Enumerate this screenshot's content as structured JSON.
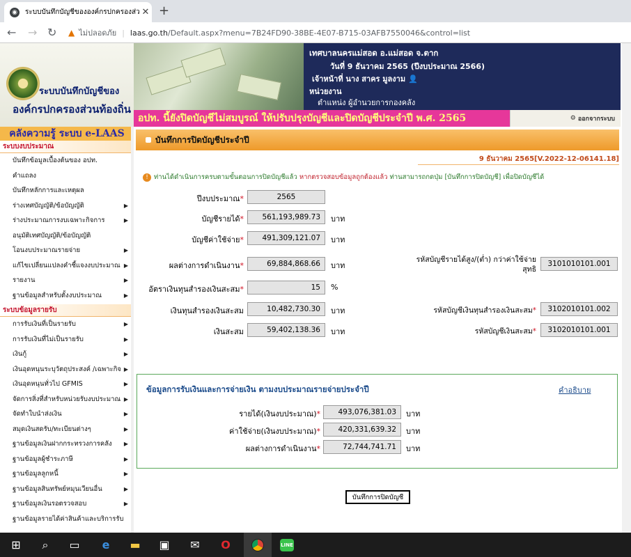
{
  "browser": {
    "tab_title": "ระบบบันทึกบัญชีขององค์กรปกครองส่วนท้องถิ่น",
    "new_tab": "+",
    "security_text": "ไม่ปลอดภัย",
    "url_host": "laas.go.th",
    "url_path": "/Default.aspx?menu=7B24FD90-38BE-4E07-B715-03AFB7550046&control=list"
  },
  "header": {
    "app_title": "ระบบบันทึกบัญชีของ",
    "org_name": "องค์กรปกครองส่วนท้องถิ่น",
    "municipality": "เทศบาลนครแม่สอด อ.แม่สอด จ.ตาก",
    "date_line": "วันที่ 9 ธันวาคม 2565  (ปีงบประมาณ 2566)",
    "officer": "เจ้าหน้าที่ นาง สาคร มูลงาม",
    "unit": "หน่วยงาน",
    "position": "ตำแหน่ง ผู้อำนวยการกองคลัง",
    "marquee": "อปท. นี้ยังปิดบัญชีไม่สมบูรณ์ ให้ปรับปรุงบัญชีและปิดบัญชีประจำปี พ.ศ. 2565",
    "logout": "ออกจากระบบ"
  },
  "sidebar": {
    "knowledge": "คลังความรู้ ระบบ e-LAAS",
    "section1": "ระบบงบประมาณ",
    "items1": [
      {
        "label": "บันทึกข้อมูลเบื้องต้นของ อปท.",
        "arrow": ""
      },
      {
        "label": "คำแถลง",
        "arrow": ""
      },
      {
        "label": "บันทึกหลักการและเหตุผล",
        "arrow": ""
      },
      {
        "label": "ร่างเทศบัญญัติ/ข้อบัญญัติ",
        "arrow": "▶"
      },
      {
        "label": "ร่างประมาณการงบเฉพาะกิจการ",
        "arrow": "▶"
      },
      {
        "label": "อนุมัติเทศบัญญัติ/ข้อบัญญัติ",
        "arrow": ""
      },
      {
        "label": "โอนงบประมาณรายจ่าย",
        "arrow": "▶"
      },
      {
        "label": "แก้ไขเปลี่ยนแปลงคำชี้แจงงบประมาณ",
        "arrow": "▶"
      },
      {
        "label": "รายงาน",
        "arrow": "▶"
      },
      {
        "label": "ฐานข้อมูลสำหรับตั้งงบประมาณ",
        "arrow": "▶"
      }
    ],
    "section2": "ระบบข้อมูลรายรับ",
    "items2": [
      {
        "label": "การรับเงินที่เป็นรายรับ",
        "arrow": "▶"
      },
      {
        "label": "การรับเงินที่ไม่เป็นรายรับ",
        "arrow": "▶"
      },
      {
        "label": "เงินกู้",
        "arrow": "▶"
      },
      {
        "label": "เงินอุดหนุนระบุวัตถุประสงค์ /เฉพาะกิจ",
        "arrow": "▶"
      },
      {
        "label": "เงินอุดหนุนทั่วไป GFMIS",
        "arrow": "▶"
      },
      {
        "label": "จัดการสิ่งที่สำหรับหน่วยรับงบประมาณ",
        "arrow": "▶"
      },
      {
        "label": "จัดทำใบนำส่งเงิน",
        "arrow": "▶"
      },
      {
        "label": "สมุดเงินสดรับ/ทะเบียนต่างๆ",
        "arrow": "▶"
      },
      {
        "label": "ฐานข้อมูลเงินฝากกระทรวงการคลัง",
        "arrow": "▶"
      },
      {
        "label": "ฐานข้อมูลผู้ชำระภาษี",
        "arrow": "▶"
      },
      {
        "label": "ฐานข้อมูลลูกหนี้",
        "arrow": "▶"
      },
      {
        "label": "ฐานข้อมูลสินทรัพย์หมุนเวียนอื่น",
        "arrow": "▶"
      },
      {
        "label": "ฐานข้อมูลเงินรอตรวจสอบ",
        "arrow": "▶"
      },
      {
        "label": "ฐานข้อมูลรายได้ค่าสินค้าและบริการรับ",
        "arrow": ""
      }
    ]
  },
  "main": {
    "page_title": "บันทึกการปิดบัญชีประจำปี",
    "date_version": "9 ธันวาคม 2565[V.2022-12-06141.18]",
    "notice_1": "ท่านได้ดำเนินการครบตามขั้นตอนการปิดบัญชีแล้ว",
    "notice_2": "หากตรวจสอบข้อมูลถูกต้องแล้ว",
    "notice_3": "ท่านสามารถกดปุ่ม [บันทึกการปิดบัญชี] เพื่อปิดบัญชีได้",
    "fields": {
      "fiscal_year": {
        "label": "ปีงบประมาณ",
        "value": "2565"
      },
      "revenue": {
        "label": "บัญชีรายได้",
        "value": "561,193,989.73",
        "unit": "บาท"
      },
      "expense": {
        "label": "บัญชีค่าใช้จ่าย",
        "value": "491,309,121.07",
        "unit": "บาท"
      },
      "result": {
        "label": "ผลต่างการดำเนินงาน",
        "value": "69,884,868.66",
        "unit": "บาท"
      },
      "reserve_rate": {
        "label": "อัตราเงินทุนสำรองเงินสะสม",
        "value": "15",
        "unit": "%"
      },
      "reserve_fund": {
        "label": "เงินทุนสำรองเงินสะสม",
        "value": "10,482,730.30",
        "unit": "บาท"
      },
      "accumulated": {
        "label": "เงินสะสม",
        "value": "59,402,138.36",
        "unit": "บาท"
      }
    },
    "codes": {
      "net_code_label_1": "รหัสบัญชีรายได้สูง/(ต่ำ) กว่าค่าใช้จ่าย",
      "net_code_label_2": "สุทธิ",
      "net_code": "3101010101.001",
      "reserve_code_label": "รหัสบัญชีเงินทุนสำรองเงินสะสม",
      "reserve_code": "3102010101.002",
      "accumulated_code_label": "รหัสบัญชีเงินสะสม",
      "accumulated_code": "3102010101.001"
    },
    "panel": {
      "title": "ข้อมูลการรับเงินและการจ่ายเงิน ตามงบประมาณรายจ่ายประจำปี",
      "explain": "คำอธิบาย",
      "income_label": "รายได้(เงินงบประมาณ)",
      "income": "493,076,381.03",
      "spend_label": "ค่าใช้จ่าย(เงินงบประมาณ)",
      "spend": "420,331,639.32",
      "diff_label": "ผลต่างการดำเนินงาน",
      "diff": "72,744,741.71",
      "unit": "บาท"
    },
    "close_button": "บันทึกการปิดบัญชี",
    "required_mark": "*"
  }
}
